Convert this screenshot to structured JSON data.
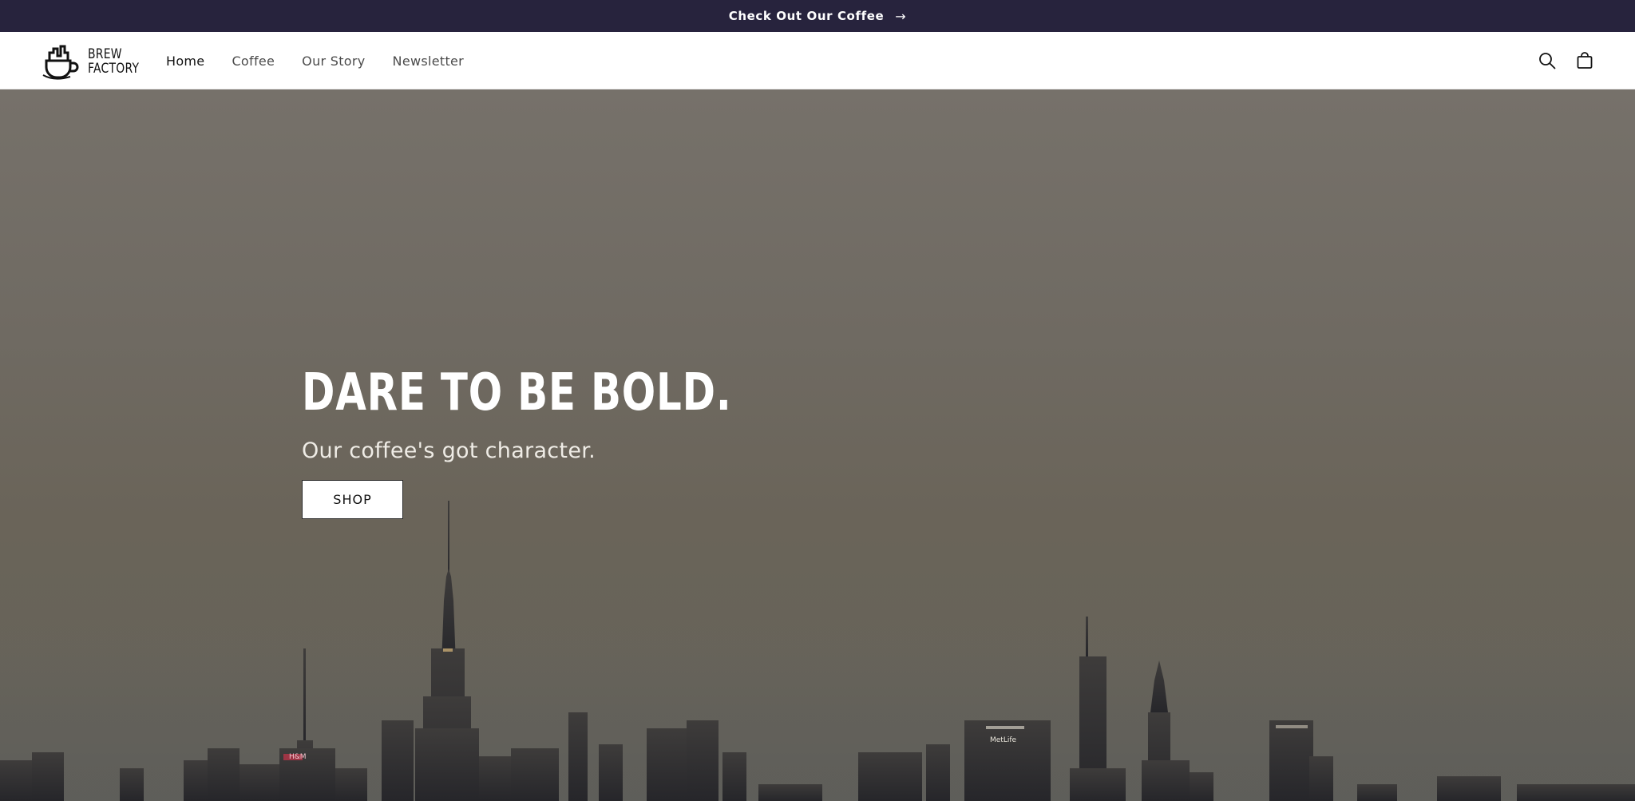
{
  "announcement": {
    "text": "Check Out Our Coffee",
    "arrow_icon": "arrow-right-icon"
  },
  "header": {
    "logo": {
      "line1": "BREW",
      "line2": "FACTORY",
      "icon": "coffee-cup-skyline-icon"
    },
    "nav": [
      {
        "label": "Home",
        "active": true
      },
      {
        "label": "Coffee",
        "active": false
      },
      {
        "label": "Our Story",
        "active": false
      },
      {
        "label": "Newsletter",
        "active": false
      }
    ],
    "icons": {
      "search": "search-icon",
      "cart": "cart-icon"
    }
  },
  "hero": {
    "title": "DARE TO BE BOLD.",
    "subtitle": "Our coffee's got character.",
    "button_label": "SHOP",
    "building_signs": [
      "H&M",
      "MetLife"
    ]
  },
  "colors": {
    "announcement_bg": "#27233d",
    "header_bg": "#ffffff",
    "hero_sky": "#76716a",
    "button_bg": "#ffffff",
    "text_dark": "#121212"
  }
}
